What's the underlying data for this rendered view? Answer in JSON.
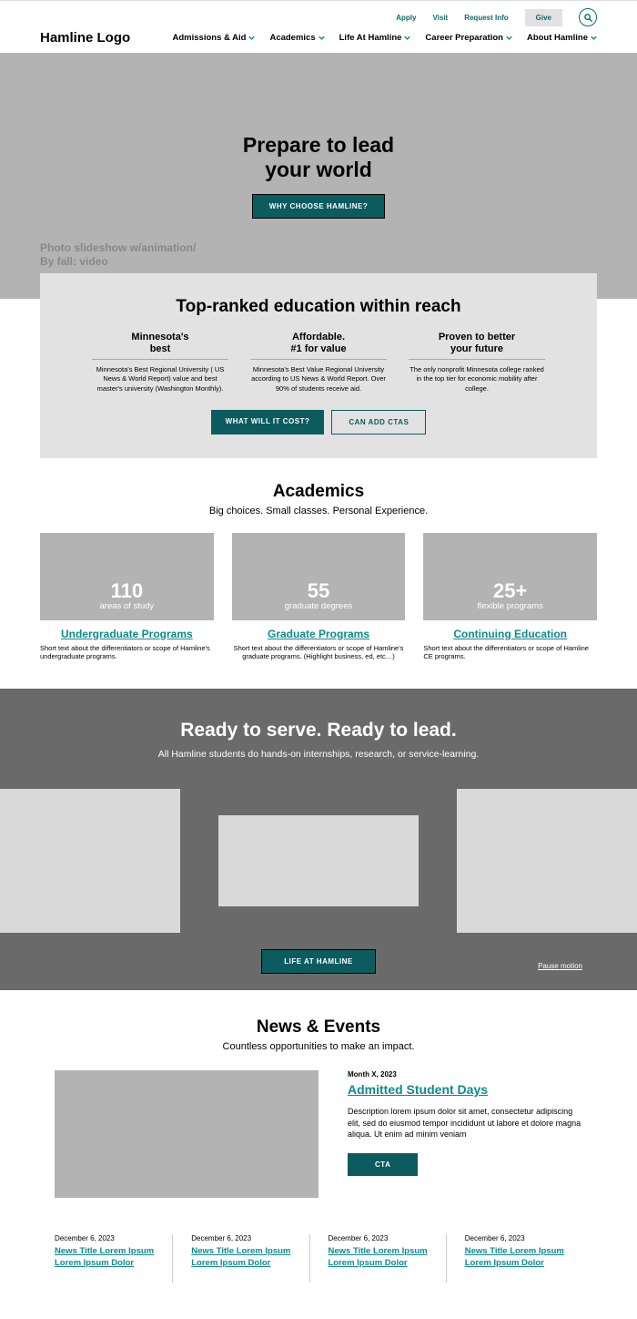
{
  "header": {
    "logo": "Hamline Logo",
    "util": {
      "apply": "Apply",
      "visit": "Visit",
      "request": "Request Info",
      "give": "Give"
    },
    "nav": {
      "admissions": "Admissions & Aid",
      "academics": "Academics",
      "life": "Life At Hamline",
      "career": "Career Preparation",
      "about": "About Hamline"
    }
  },
  "hero": {
    "title_l1": "Prepare to lead",
    "title_l2": "your world",
    "cta": "WHY CHOOSE HAMLINE?",
    "note_l1": "Photo slideshow w/animation/",
    "note_l2": "By fall: video"
  },
  "ranked": {
    "title": "Top-ranked education within reach",
    "p1_h_l1": "Minnesota's",
    "p1_h_l2": "best",
    "p1_body": "Minnesota's Best Regional University ( US News & World Report) value and best master's university (Washington Monthly).",
    "p2_h_l1": "Affordable.",
    "p2_h_l2": "#1 for value",
    "p2_body": "Minnesota's Best Value Regional University according to US News & World Report. Over 90% of students receive aid.",
    "p3_h_l1": "Proven to better",
    "p3_h_l2": "your future",
    "p3_body": "The only nonprofit Minnesota college ranked in the top tier for economic mobility after college.",
    "cta1": "WHAT WILL IT COST?",
    "cta2": "CAN ADD CTAS"
  },
  "academics": {
    "title": "Academics",
    "sub": "Big choices. Small classes. Personal Experience.",
    "c1_num": "110",
    "c1_lab": "areas of study",
    "c1_link": "Undergraduate Programs",
    "c1_desc": "Short text about the differentiators or scope of Hamline's undergraduate programs.",
    "c2_num": "55",
    "c2_lab": "graduate degrees",
    "c2_link": "Graduate Programs",
    "c2_desc": "Short text about the differentiators or scope of Hamline's graduate programs. (Highlight business, ed, etc…)",
    "c3_num": "25+",
    "c3_lab": "flexible programs",
    "c3_link": "Continuing Education",
    "c3_desc": "Short text about the differentiators or scope of Hamline CE programs."
  },
  "serve": {
    "title": "Ready to serve. Ready to lead.",
    "sub": "All Hamline students do hands-on internships, research, or service-learning.",
    "cta": "LIFE AT HAMLINE",
    "pause": "Pause motion"
  },
  "news": {
    "title": "News & Events",
    "sub": "Countless opportunities to make an impact.",
    "feature": {
      "date": "Month X, 2023",
      "title": "Admitted Student Days",
      "desc": "Description lorem ipsum dolor sit amet, consectetur adipiscing elit, sed do eiusmod tempor incididunt ut labore et dolore magna aliqua. Ut enim ad minim veniam",
      "cta": "CTA"
    },
    "items": [
      {
        "date": "December 6, 2023",
        "title": "News Title Lorem Ipsum Lorem Ipsum Dolor"
      },
      {
        "date": "December 6, 2023",
        "title": "News Title Lorem Ipsum Lorem Ipsum Dolor"
      },
      {
        "date": "December 6, 2023",
        "title": "News Title Lorem Ipsum Lorem Ipsum Dolor"
      },
      {
        "date": "December 6, 2023",
        "title": "News Title Lorem Ipsum Lorem Ipsum Dolor"
      }
    ]
  }
}
